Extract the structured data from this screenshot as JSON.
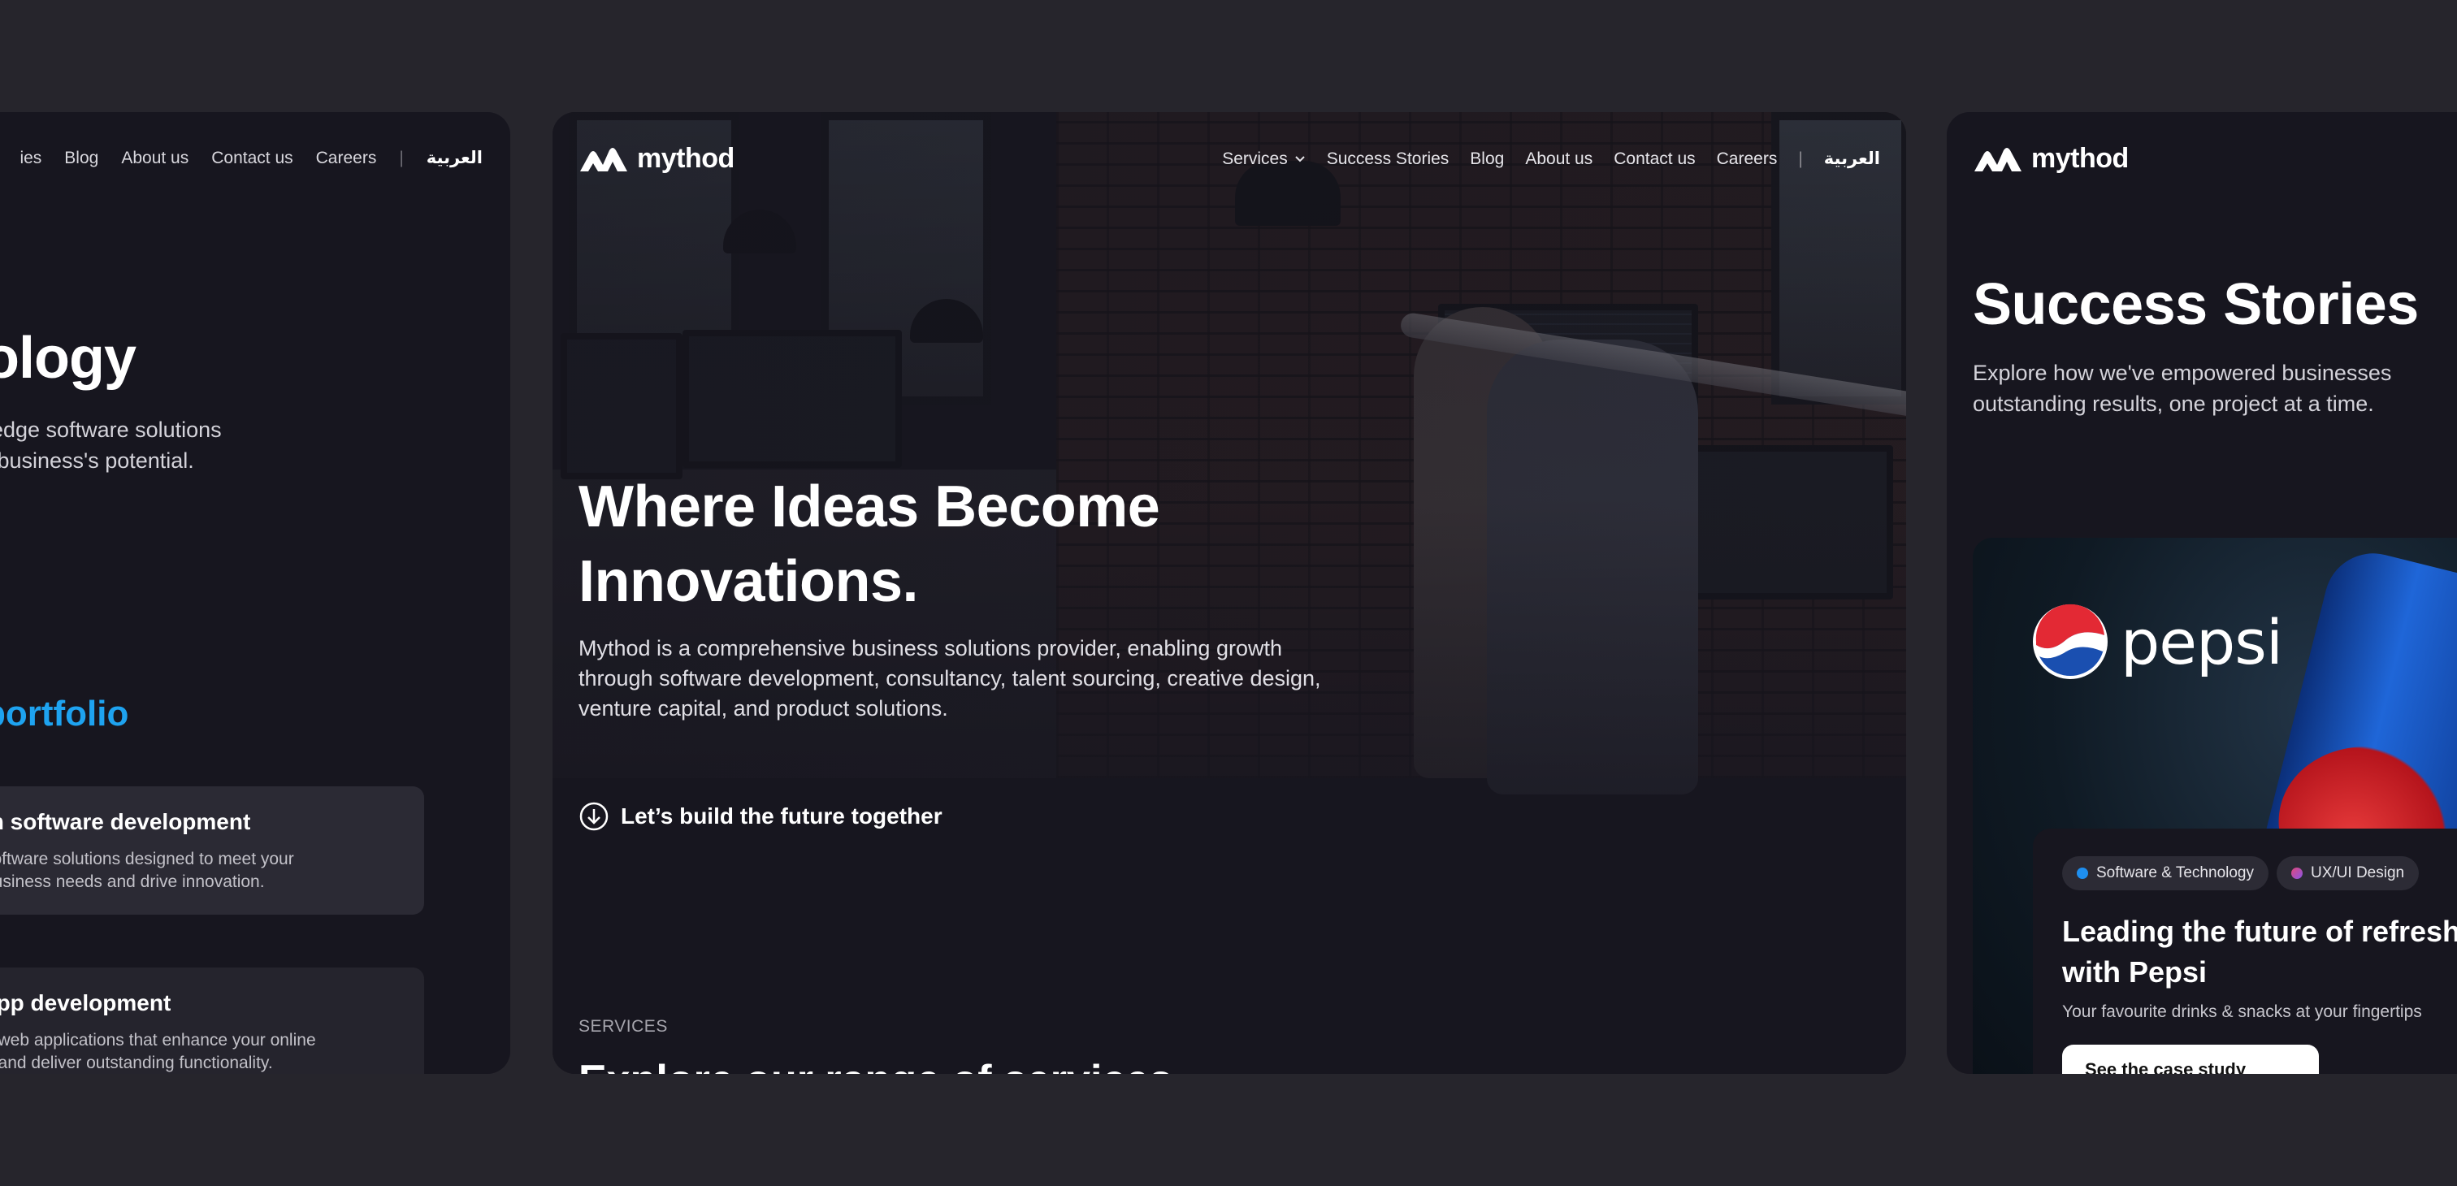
{
  "left_card": {
    "nav": [
      "ies",
      "Blog",
      "About us",
      "Contact us",
      "Careers"
    ],
    "nav_separator": "|",
    "language": "العربية",
    "title": "ology",
    "description": [
      "-edge software solutions",
      "r business's potential."
    ],
    "portfolio_heading": "portfolio",
    "services": [
      {
        "title": "m software development",
        "lines": [
          " software solutions designed to meet your",
          "business needs and drive innovation."
        ]
      },
      {
        "title": "app development",
        "lines": [
          "g web applications that enhance your online",
          "e and deliver outstanding functionality."
        ]
      }
    ]
  },
  "center_card": {
    "logo_text": "mythod",
    "nav": {
      "services": "Services",
      "success_stories": "Success Stories",
      "blog": "Blog",
      "about": "About us",
      "contact": "Contact us",
      "careers": "Careers",
      "separator": "|",
      "language": "العربية"
    },
    "hero_title_line1": "Where Ideas Become",
    "hero_title_line2": "Innovations.",
    "hero_description": "Mythod is a comprehensive business solutions provider, enabling growth through software development, consultancy, talent sourcing, creative design, venture capital, and product solutions.",
    "cta": "Let’s build the future together",
    "services_label": "SERVICES",
    "services_heading": "Explore our range of services"
  },
  "right_card": {
    "logo_text": "mythod",
    "title": "Success Stories",
    "description": [
      "Explore how we've empowered businesses",
      "outstanding results, one project at a time."
    ],
    "client_logo": "pepsi",
    "tags": [
      {
        "label": "Software & Technology",
        "color": "#1e8ff0"
      },
      {
        "label": "UX/UI Design",
        "color": "#e0487a"
      }
    ],
    "story_title": "Leading the future of refreshment with Pepsi",
    "story_subtitle": "Your favourite drinks & snacks at your fingertips",
    "story_button": "See the case study"
  },
  "colors": {
    "background": "#26252c",
    "card": "#17161f",
    "accent": "#1ea3f0"
  }
}
